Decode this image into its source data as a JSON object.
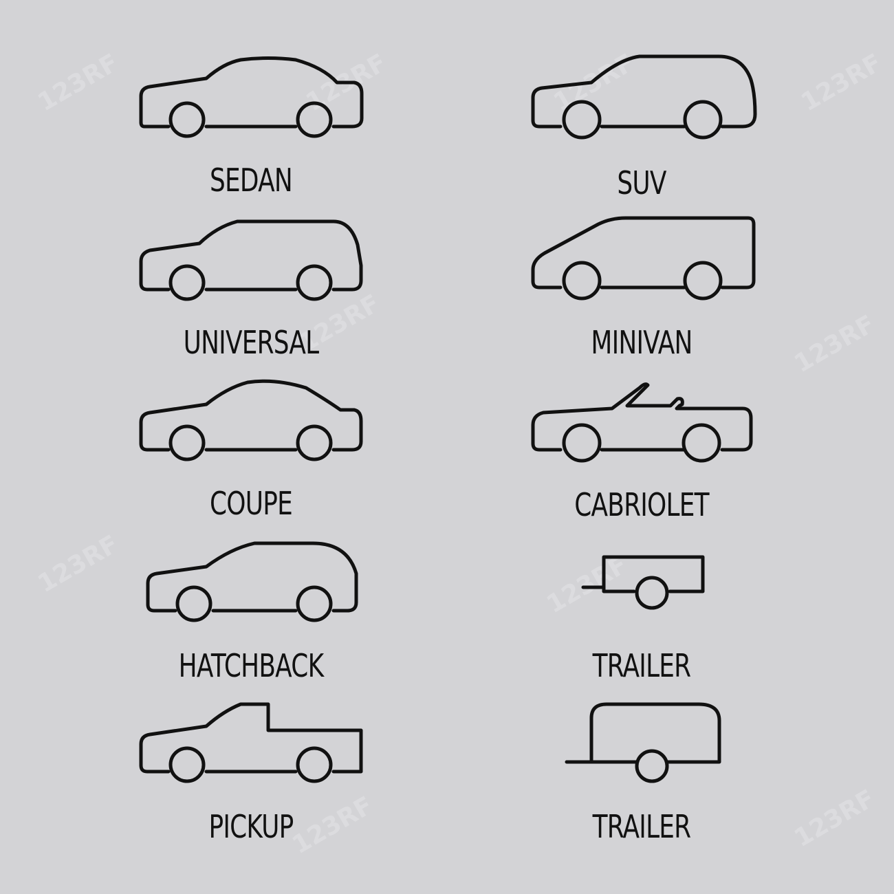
{
  "labels": {
    "sedan": "SEDAN",
    "suv": "SUV",
    "universal": "UNIVERSAL",
    "minivan": "MINIVAN",
    "coupe": "COUPE",
    "cabriolet": "CABRIOLET",
    "hatchback": "HATCHBACK",
    "trailer1": "TRAILER",
    "pickup": "PICKUP",
    "trailer2": "TRAILER"
  },
  "watermark": "123RF",
  "colors": {
    "background": "#d3d3d6",
    "stroke": "#111111"
  }
}
